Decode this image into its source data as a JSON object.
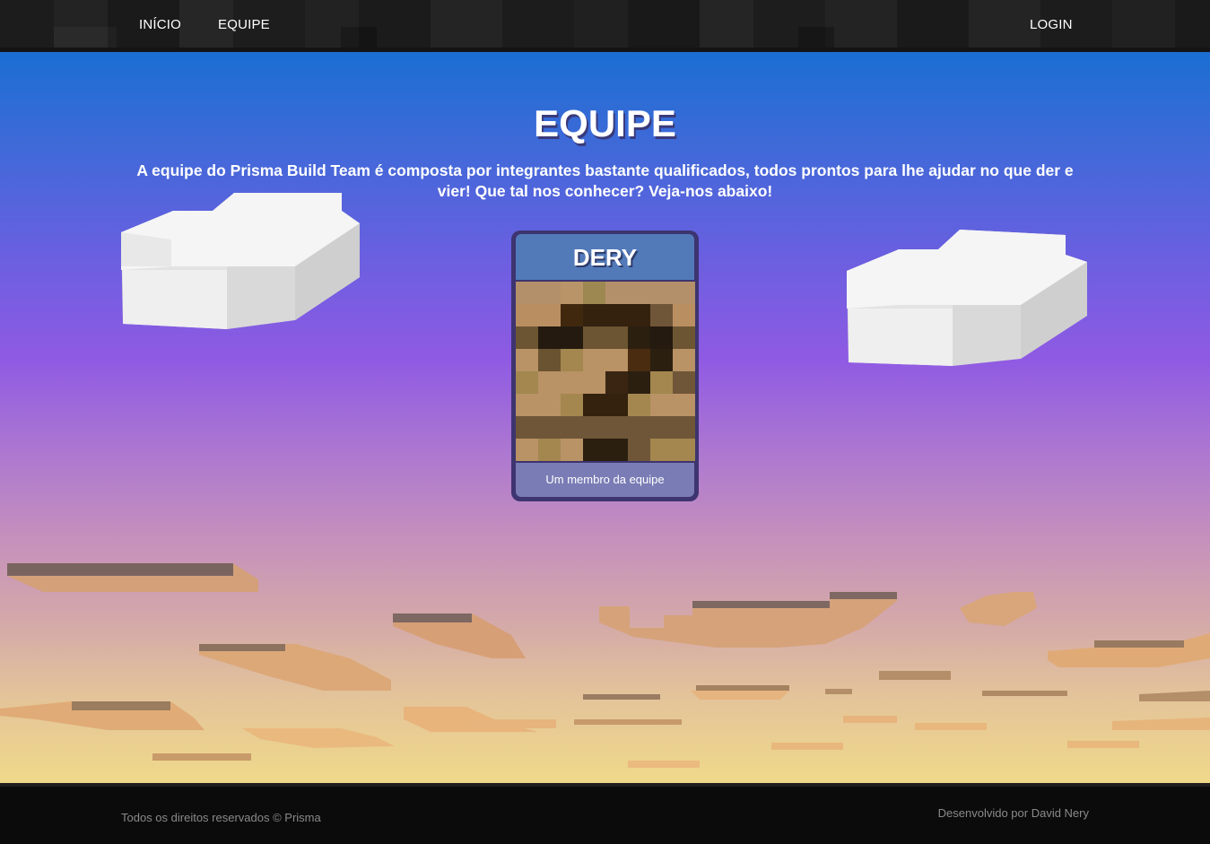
{
  "nav": {
    "home_label": "INÍCIO",
    "team_label": "EQUIPE",
    "login_label": "LOGIN"
  },
  "hero": {
    "title": "EQUIPE",
    "description": "A equipe do Prisma Build Team é composta por integrantes bastante qualificados, todos prontos para lhe ajudar no que der e vier! Que tal nos conhecer? Veja-nos abaixo!"
  },
  "members": [
    {
      "name": "DERY",
      "role": "Um membro da equipe",
      "avatar_pixels": [
        [
          "#b4906a",
          "#b4906a",
          "#b89468",
          "#9c8850",
          "#b4906a",
          "#b4906a",
          "#b4906a",
          "#b4906a"
        ],
        [
          "#b98f62",
          "#b98f62",
          "#40280f",
          "#34210e",
          "#34210e",
          "#34210e",
          "#6f5638",
          "#b98f62"
        ],
        [
          "#6c5532",
          "#241a10",
          "#241a10",
          "#6c5532",
          "#6c5532",
          "#2b1f10",
          "#241a10",
          "#6c5532"
        ],
        [
          "#b99265",
          "#6a5330",
          "#a3874f",
          "#b99265",
          "#b99265",
          "#4a2c10",
          "#2b1f10",
          "#b99265"
        ],
        [
          "#a3874f",
          "#b99265",
          "#b99265",
          "#b99265",
          "#3a2512",
          "#2b1f10",
          "#a3874f",
          "#6f5638"
        ],
        [
          "#b99265",
          "#b99265",
          "#a3874f",
          "#34210e",
          "#34210e",
          "#a3874f",
          "#b99265",
          "#b99265"
        ],
        [
          "#6f5638",
          "#6f5638",
          "#6f5638",
          "#6f5638",
          "#6f5638",
          "#6f5638",
          "#6f5638",
          "#6f5638"
        ],
        [
          "#b99265",
          "#a3874f",
          "#b99265",
          "#2b1f10",
          "#2b1f10",
          "#6f5638",
          "#a3874f",
          "#a3874f"
        ]
      ]
    }
  ],
  "footer": {
    "copyright": "Todos os direitos reservados © Prisma",
    "credit": "Desenvolvido por David Nery"
  }
}
